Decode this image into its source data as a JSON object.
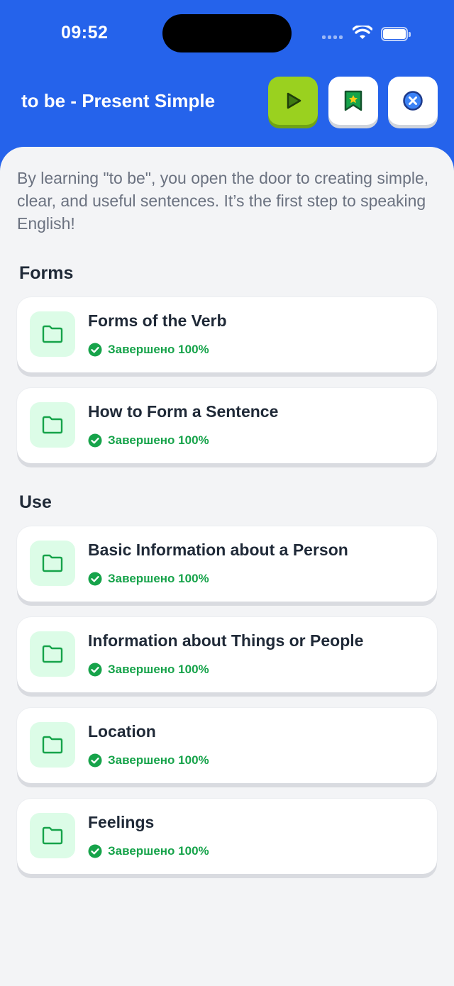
{
  "status_bar": {
    "time": "09:52"
  },
  "header": {
    "title": "to be - Present Simple",
    "buttons": {
      "play_icon": "play-icon",
      "bookmark_icon": "bookmark-star-icon",
      "close_icon": "close-circle-icon"
    }
  },
  "intro": "By learning \"to be\", you open the door to creating simple, clear, and useful sentences. It’s the first step to speaking English!",
  "sections": [
    {
      "title": "Forms",
      "items": [
        {
          "title": "Forms of the Verb",
          "status": "Завершено 100%"
        },
        {
          "title": "How to Form a Sentence",
          "status": "Завершено 100%"
        }
      ]
    },
    {
      "title": "Use",
      "items": [
        {
          "title": "Basic Information about a Person",
          "status": "Завершено 100%"
        },
        {
          "title": "Information about Things or People",
          "status": "Завершено 100%"
        },
        {
          "title": "Location",
          "status": "Завершено 100%"
        },
        {
          "title": "Feelings",
          "status": "Завершено 100%"
        }
      ]
    }
  ],
  "colors": {
    "primary": "#2563eb",
    "play_button": "#9ad11f",
    "success": "#16a34a",
    "folder_bg": "#dcfce7"
  }
}
